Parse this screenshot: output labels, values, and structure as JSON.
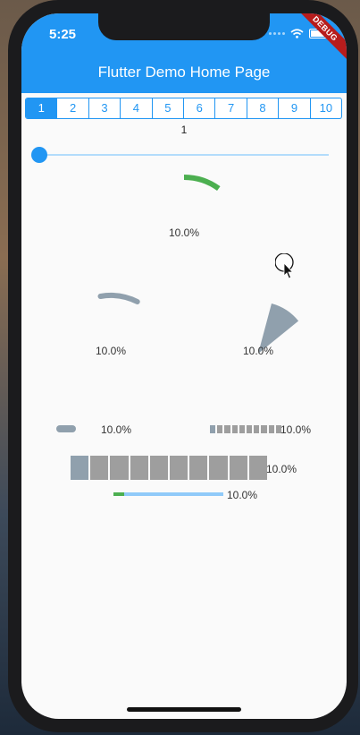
{
  "status": {
    "time": "5:25"
  },
  "debug_label": "DEBUG",
  "appbar": {
    "title": "Flutter Demo Home Page"
  },
  "segments": [
    "1",
    "2",
    "3",
    "4",
    "5",
    "6",
    "7",
    "8",
    "9",
    "10"
  ],
  "selected_segment": "1",
  "slider": {
    "value_label": "1",
    "value": 1,
    "min": 1,
    "max": 10
  },
  "progress": {
    "value": 0.1,
    "labels": {
      "arc_main": "10.0%",
      "arc_left": "10.0%",
      "pie_right": "10.0%",
      "capsule": "10.0%",
      "step_small": "10.0%",
      "step_large": "10.0%",
      "linear": "10.0%"
    }
  },
  "colors": {
    "primary": "#2196f3",
    "progress_green": "#4caf50",
    "inactive_grey": "#9e9e9e",
    "blue_grey": "#90a0ad",
    "linear_track": "#90caf9"
  }
}
